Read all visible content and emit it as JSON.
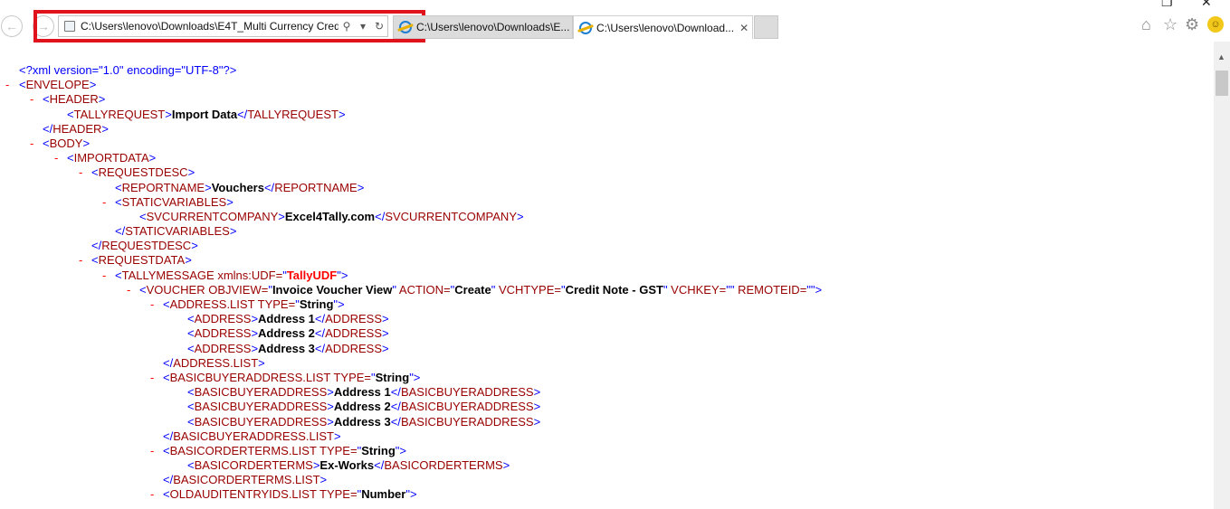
{
  "window": {
    "restore_glyph": "❐",
    "close_glyph": "✕"
  },
  "nav": {
    "back_icon": "back-arrow-icon",
    "forward_icon": "forward-arrow-icon"
  },
  "address_bar": {
    "url": "C:\\Users\\lenovo\\Downloads\\E4T_Multi Currency Cred",
    "search_icon": "⚲",
    "dropdown_icon": "▾",
    "refresh_icon": "↻"
  },
  "tabs": [
    {
      "label": "C:\\Users\\lenovo\\Downloads\\E...",
      "active": false
    },
    {
      "label": "C:\\Users\\lenovo\\Download...",
      "active": true,
      "close": "✕"
    }
  ],
  "toolbar": {
    "home_icon": "⌂",
    "favorites_icon": "☆",
    "settings_icon": "⚙",
    "feedback_icon": "☺"
  },
  "xml": {
    "declaration": "<?xml version=\"1.0\" encoding=\"UTF-8\"?>",
    "dash": "-",
    "envelope": "ENVELOPE",
    "header": "HEADER",
    "tallyrequest": "TALLYREQUEST",
    "tallyrequest_value": "Import Data",
    "body": "BODY",
    "importdata": "IMPORTDATA",
    "requestdesc": "REQUESTDESC",
    "reportname": "REPORTNAME",
    "reportname_value": "Vouchers",
    "staticvariables": "STATICVARIABLES",
    "svcurrentcompany": "SVCURRENTCOMPANY",
    "svcurrentcompany_value": "Excel4Tally.com",
    "requestdata": "REQUESTDATA",
    "tallymessage_open": "TALLYMESSAGE xmlns:UDF=",
    "tallymessage_ns": "TallyUDF",
    "voucher_open": "VOUCHER OBJVIEW=",
    "voucher_objview": "Invoice Voucher View",
    "voucher_action_attr": " ACTION=",
    "voucher_action": "Create",
    "voucher_vchtype_attr": " VCHTYPE=",
    "voucher_vchtype": "Credit Note - GST",
    "voucher_vchkey_attr": " VCHKEY=",
    "voucher_remoteid_attr": " REMOTEID=",
    "address_list_open": "ADDRESS.LIST TYPE=",
    "address_list_close": "ADDRESS.LIST",
    "list_type_value": "String",
    "address": "ADDRESS",
    "address_values": [
      "Address 1",
      "Address 2",
      "Address 3"
    ],
    "basicbuyeraddress_list_open": "BASICBUYERADDRESS.LIST TYPE=",
    "basicbuyeraddress_list_close": "BASICBUYERADDRESS.LIST",
    "basicbuyeraddress": "BASICBUYERADDRESS",
    "basicbuyeraddress_values": [
      "Address 1",
      "Address 2",
      "Address 3"
    ],
    "basicorderterms_list_open": "BASICORDERTERMS.LIST TYPE=",
    "basicorderterms_list_close": "BASICORDERTERMS.LIST",
    "basicorderterms": "BASICORDERTERMS",
    "basicorderterms_value": "Ex-Works",
    "oldauditentryids_list_open": "OLDAUDITENTRYIDS.LIST TYPE=",
    "oldauditentryids_type": "Number"
  }
}
